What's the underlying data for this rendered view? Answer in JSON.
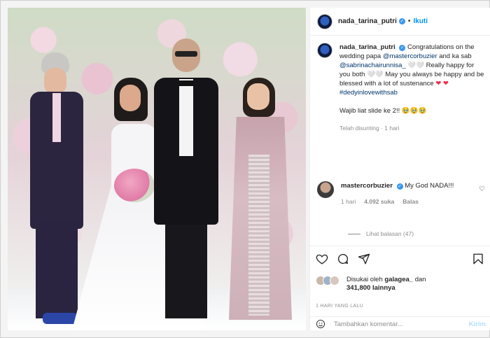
{
  "post": {
    "username": "nada_tarina_putri",
    "follow_label": "Ikuti",
    "dot": "•"
  },
  "caption": {
    "username": "nada_tarina_putri",
    "line1": "Congratulations on the wedding papa ",
    "mention1": "@mastercorbuzier",
    "line2": " and ka sab ",
    "mention2": "@sabrinachairunnisa_",
    "line3": " 🤍🤍 Really happy for you both 🤍🤍 May you always be happy and be blessed with a lot of sustenance ",
    "heart1": "❤",
    "heart2": "❤",
    "hashtag": "#dedyinlovewithsab",
    "line4": "Wajib liat slide ke 2!! 🥹🥹🥹",
    "meta": "Telah disunting · 1 hari"
  },
  "comment": {
    "username": "mastercorbuzier",
    "text": "My God NADA!!!",
    "time": "1 hari",
    "likes": "4.092 suka",
    "reply": "Balas",
    "view_replies": "Lihat balasan (47)"
  },
  "likes": {
    "line1_prefix": "Disukai oleh ",
    "liker": "galagea_",
    "line1_suffix": " dan",
    "line2": "341,800 lainnya"
  },
  "timestamp": "1 HARI YANG LALU",
  "add_comment": {
    "placeholder": "Tambahkan komentar...",
    "post_label": "Kirim"
  },
  "icons": {
    "like": "heart-icon",
    "comment": "comment-icon",
    "share": "share-icon",
    "save": "bookmark-icon",
    "emoji": "emoji-icon"
  },
  "colors": {
    "link": "#00376b",
    "follow": "#0095f6",
    "heart": "#ed2d4b",
    "verified": "#3897f0",
    "muted": "#8e8e8e"
  }
}
